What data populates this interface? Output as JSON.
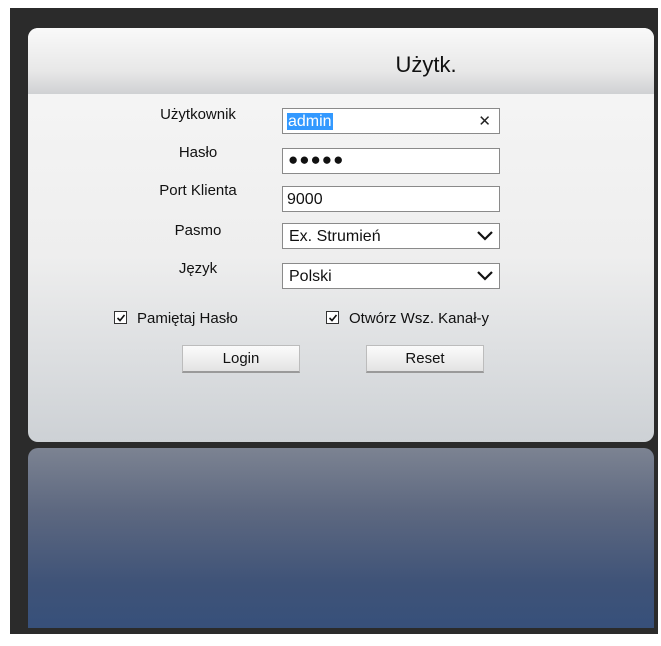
{
  "title": "Użytk.",
  "fields": {
    "username": {
      "label": "Użytkownik",
      "value": "admin",
      "clear_icon": "close-icon"
    },
    "password": {
      "label": "Hasło",
      "value": "●●●●●"
    },
    "port": {
      "label": "Port Klienta",
      "value": "9000"
    },
    "stream": {
      "label": "Pasmo",
      "value": "Ex. Strumień"
    },
    "language": {
      "label": "Język",
      "value": "Polski"
    }
  },
  "checkboxes": {
    "remember": {
      "label": "Pamiętaj Hasło",
      "checked": true
    },
    "open_all": {
      "label": "Otwórz Wsz. Kanał-y",
      "checked": true
    }
  },
  "buttons": {
    "login": "Login",
    "reset": "Reset"
  },
  "colors": {
    "accent_selection": "#3399ff",
    "frame_bg": "#2b2b2b",
    "reflection": "#3f5378"
  }
}
